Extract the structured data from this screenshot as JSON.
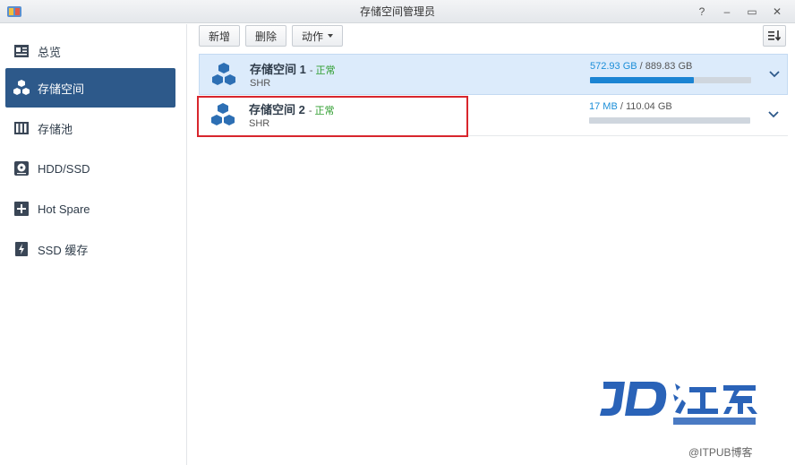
{
  "window": {
    "title": "存储空间管理员",
    "controls": [
      "?",
      "–",
      "▭",
      "✕"
    ]
  },
  "sidebar": {
    "items": [
      {
        "label": "总览",
        "icon": "overview-icon"
      },
      {
        "label": "存储空间",
        "icon": "cubes-icon",
        "active": true
      },
      {
        "label": "存储池",
        "icon": "storage-pool-icon"
      },
      {
        "label": "HDD/SSD",
        "icon": "hdd-icon"
      },
      {
        "label": "Hot Spare",
        "icon": "hot-spare-icon"
      },
      {
        "label": "SSD 缓存",
        "icon": "ssd-cache-icon"
      }
    ]
  },
  "toolbar": {
    "new_label": "新增",
    "delete_label": "删除",
    "action_label": "动作"
  },
  "volumes": [
    {
      "name": "存储空间 1",
      "separator": "-",
      "status": "正常",
      "type": "SHR",
      "used": "572.93 GB",
      "total": "/ 889.83 GB",
      "usage_fraction": 0.644,
      "selected": true
    },
    {
      "name": "存储空间 2",
      "separator": "-",
      "status": "正常",
      "type": "SHR",
      "used": "17 MB",
      "total": "/ 110.04 GB",
      "usage_fraction": 0.0,
      "selected": false
    }
  ],
  "watermark": {
    "text": "@ITPUB博客"
  },
  "colors": {
    "accent": "#2d598a",
    "status_ok": "#2e9d2e",
    "usage_used": "#1b8ed8",
    "highlight": "#d8262d"
  }
}
